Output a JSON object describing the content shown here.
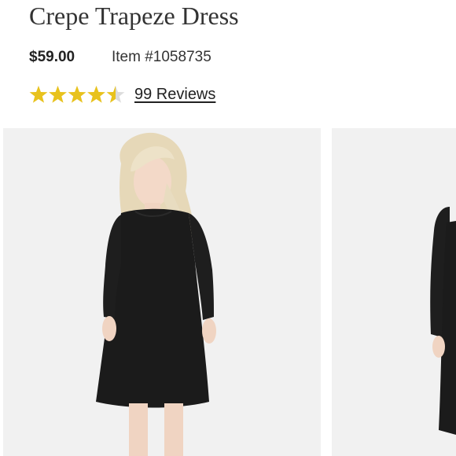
{
  "product": {
    "title": "Crepe Trapeze Dress",
    "price": "$59.00",
    "item_number": "Item #1058735"
  },
  "rating": {
    "stars": 4.5,
    "max_stars": 5,
    "reviews_label": "99 Reviews"
  },
  "colors": {
    "star_filled": "#E8C21D",
    "star_empty": "#DCDCDC",
    "image_background": "#F1F1F1",
    "dress": "#1B1B1B",
    "hair": "#E8DCC0"
  },
  "gallery": {
    "images": [
      {
        "name": "main-product-image",
        "description_icon": "model-in-black-dress"
      },
      {
        "name": "next-product-image",
        "description_icon": "model-in-black-dress-side"
      }
    ]
  }
}
